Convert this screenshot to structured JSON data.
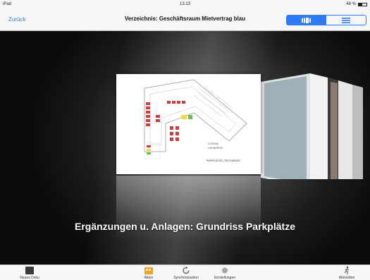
{
  "status": {
    "device": "iPad",
    "time": "13:13",
    "battery": "48 %"
  },
  "nav": {
    "back_label": "Zurück",
    "title": "Verzeichnis: Geschäftsraum Mietvertrag blau"
  },
  "viewer": {
    "caption": "Ergänzungen u. Anlagen: Grundriss Parkplätze",
    "plan_label_1": "SCHEMA",
    "plan_label_2": "GRUNDRISS",
    "plan_footer": "PARKPLÄTZE | TIEFGARAGE"
  },
  "tabbar": {
    "items": [
      {
        "label": "Neues Doku",
        "icon": "document-icon"
      },
      {
        "label": "Akten",
        "icon": "folder-icon"
      },
      {
        "label": "Synchronisation",
        "icon": "sync-icon"
      },
      {
        "label": "Einstellungen",
        "icon": "gear-icon"
      },
      {
        "label": "Abmelden",
        "icon": "logout-icon"
      }
    ]
  },
  "colors": {
    "accent": "#2f7bf5",
    "folder": "#f0a422"
  }
}
